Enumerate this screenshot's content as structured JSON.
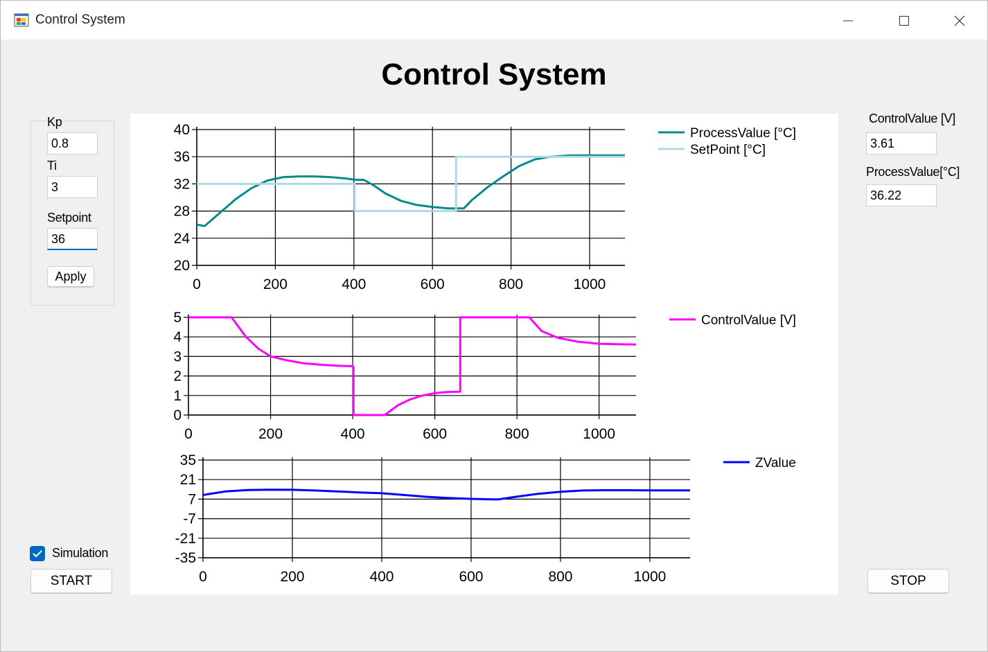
{
  "window": {
    "title": "Control System",
    "heading": "Control System",
    "accent": "#0067c0"
  },
  "params": {
    "kp_label": "Kp",
    "kp_value": "0.8",
    "ti_label": "Ti",
    "ti_value": "3",
    "setpoint_label": "Setpoint",
    "setpoint_value": "36",
    "apply_label": "Apply"
  },
  "sim": {
    "simulation_label": "Simulation",
    "simulation_checked": true,
    "start_label": "START",
    "stop_label": "STOP"
  },
  "readouts": {
    "control_label": "ControlValue [V]",
    "control_value": "3.61",
    "process_label": "ProcessValue[°C]",
    "process_value": "36.22"
  },
  "chart_data": [
    {
      "type": "line",
      "xlim": [
        0,
        1090
      ],
      "ylim": [
        20,
        40
      ],
      "xticks": [
        "0",
        "200",
        "400",
        "600",
        "800",
        "1000"
      ],
      "yticks": [
        "20",
        "24",
        "28",
        "32",
        "36",
        "40"
      ],
      "grid": true,
      "legend_position": "top-right",
      "series": [
        {
          "name": "ProcessValue [°C]",
          "color": "#008b8b",
          "x": [
            0,
            20,
            60,
            100,
            140,
            180,
            220,
            260,
            300,
            340,
            380,
            405,
            425,
            450,
            480,
            520,
            560,
            600,
            640,
            665,
            680,
            700,
            740,
            780,
            820,
            860,
            900,
            950,
            1000,
            1050,
            1090
          ],
          "y": [
            26,
            25.8,
            27.8,
            29.8,
            31.4,
            32.5,
            33,
            33.1,
            33.1,
            33,
            32.8,
            32.6,
            32.6,
            31.8,
            30.6,
            29.5,
            28.9,
            28.6,
            28.4,
            28.4,
            28.4,
            29.6,
            31.5,
            33.1,
            34.6,
            35.6,
            36,
            36.2,
            36.2,
            36.2,
            36.2
          ]
        },
        {
          "name": "SetPoint [°C]",
          "color": "#add8e6",
          "x": [
            0,
            402,
            402,
            660,
            660,
            1090
          ],
          "y": [
            32,
            32,
            28,
            28,
            36,
            36
          ]
        }
      ]
    },
    {
      "type": "line",
      "xlim": [
        0,
        1090
      ],
      "ylim": [
        0,
        5
      ],
      "xticks": [
        "0",
        "200",
        "400",
        "600",
        "800",
        "1000"
      ],
      "yticks": [
        "0",
        "1",
        "2",
        "3",
        "4",
        "5"
      ],
      "grid": true,
      "legend_position": "top-right",
      "series": [
        {
          "name": "ControlValue [V]",
          "color": "#ff00ff",
          "x": [
            0,
            105,
            140,
            170,
            200,
            240,
            280,
            320,
            360,
            400,
            402,
            402,
            478,
            510,
            540,
            570,
            600,
            630,
            660,
            662,
            662,
            830,
            860,
            900,
            950,
            1000,
            1050,
            1090
          ],
          "y": [
            5,
            5,
            4,
            3.4,
            3,
            2.8,
            2.65,
            2.58,
            2.53,
            2.5,
            2.45,
            0,
            0,
            0.5,
            0.8,
            1,
            1.12,
            1.18,
            1.2,
            1.2,
            5,
            5,
            4.3,
            3.95,
            3.75,
            3.65,
            3.62,
            3.61
          ]
        }
      ]
    },
    {
      "type": "line",
      "xlim": [
        0,
        1090
      ],
      "ylim": [
        -35,
        35
      ],
      "xticks": [
        "0",
        "200",
        "400",
        "600",
        "800",
        "1000"
      ],
      "yticks": [
        "35",
        "21",
        "7",
        "-7",
        "-21",
        "-35"
      ],
      "grid": true,
      "legend_position": "top-right",
      "series": [
        {
          "name": "ZValue",
          "color": "#0000ff",
          "x": [
            0,
            50,
            100,
            150,
            200,
            250,
            300,
            350,
            400,
            450,
            500,
            550,
            600,
            650,
            660,
            700,
            750,
            800,
            850,
            900,
            950,
            1000,
            1050,
            1090
          ],
          "y": [
            10,
            12.5,
            13.5,
            13.8,
            13.7,
            13.2,
            12.5,
            11.8,
            11.2,
            10,
            8.7,
            7.8,
            7.2,
            6.8,
            6.8,
            8.7,
            10.8,
            12.3,
            13.2,
            13.4,
            13.4,
            13.3,
            13.3,
            13.3
          ]
        }
      ]
    }
  ]
}
